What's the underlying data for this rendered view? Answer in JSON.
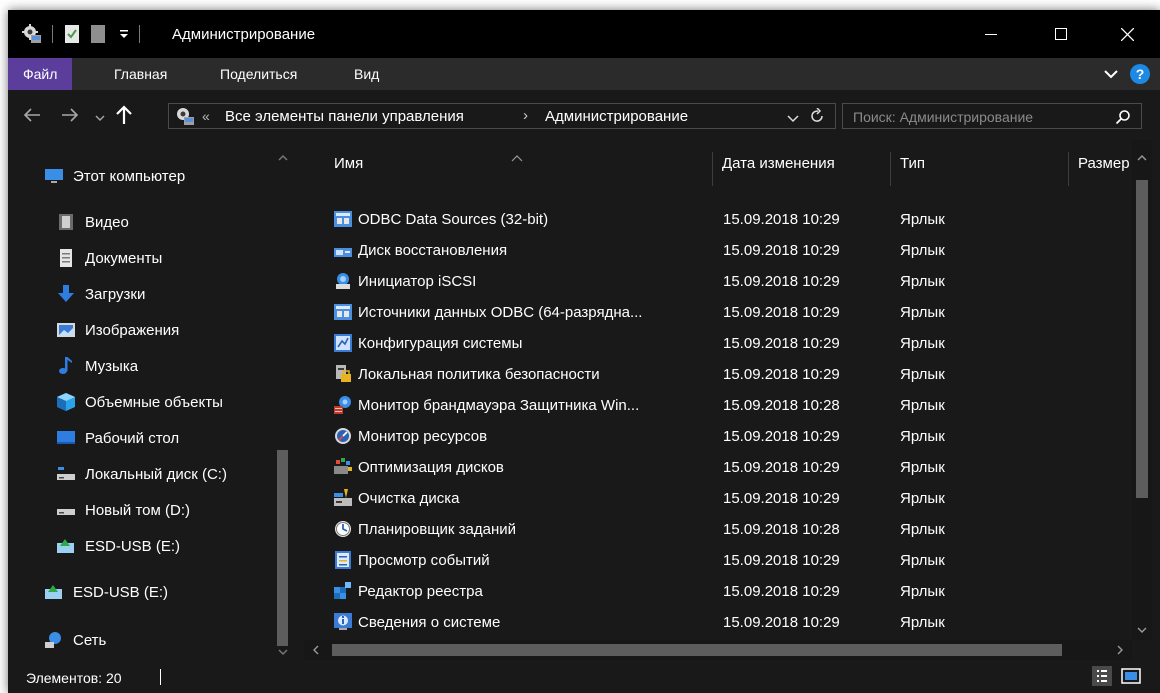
{
  "window": {
    "title": "Администрирование",
    "minimize_glyph": "—",
    "maximize_glyph": "☐",
    "close_glyph": "✕"
  },
  "ribbon": {
    "tabs": [
      "Файл",
      "Главная",
      "Поделиться",
      "Вид"
    ],
    "help_glyph": "?"
  },
  "address": {
    "overflow_glyph": "«",
    "crumbs": [
      "Все элементы панели управления",
      "Администрирование"
    ],
    "sep": "›"
  },
  "search": {
    "placeholder": "Поиск: Администрирование"
  },
  "nav": {
    "items": [
      {
        "label": "Этот компьютер",
        "icon": "monitor-icon"
      },
      {
        "label": "Видео",
        "icon": "video-icon"
      },
      {
        "label": "Документы",
        "icon": "documents-icon"
      },
      {
        "label": "Загрузки",
        "icon": "download-icon"
      },
      {
        "label": "Изображения",
        "icon": "pictures-icon"
      },
      {
        "label": "Музыка",
        "icon": "music-icon"
      },
      {
        "label": "Объемные объекты",
        "icon": "3d-objects-icon"
      },
      {
        "label": "Рабочий стол",
        "icon": "desktop-icon"
      },
      {
        "label": "Локальный диск (C:)",
        "icon": "system-drive-icon"
      },
      {
        "label": "Новый том (D:)",
        "icon": "drive-icon"
      },
      {
        "label": "ESD-USB (E:)",
        "icon": "usb-drive-icon"
      },
      {
        "label": "ESD-USB (E:)",
        "icon": "usb-drive-icon"
      },
      {
        "label": "Сеть",
        "icon": "network-icon"
      }
    ]
  },
  "columns": {
    "name": "Имя",
    "date": "Дата изменения",
    "type": "Тип",
    "size": "Размер"
  },
  "files": [
    {
      "name": "ODBC Data Sources (32-bit)",
      "date": "15.09.2018 10:29",
      "type": "Ярлык"
    },
    {
      "name": "Диск восстановления",
      "date": "15.09.2018 10:29",
      "type": "Ярлык"
    },
    {
      "name": "Инициатор iSCSI",
      "date": "15.09.2018 10:29",
      "type": "Ярлык"
    },
    {
      "name": "Источники данных ODBC (64-разрядна...",
      "date": "15.09.2018 10:29",
      "type": "Ярлык"
    },
    {
      "name": "Конфигурация системы",
      "date": "15.09.2018 10:29",
      "type": "Ярлык"
    },
    {
      "name": "Локальная политика безопасности",
      "date": "15.09.2018 10:29",
      "type": "Ярлык"
    },
    {
      "name": "Монитор брандмауэра Защитника Win...",
      "date": "15.09.2018 10:28",
      "type": "Ярлык"
    },
    {
      "name": "Монитор ресурсов",
      "date": "15.09.2018 10:29",
      "type": "Ярлык"
    },
    {
      "name": "Оптимизация дисков",
      "date": "15.09.2018 10:29",
      "type": "Ярлык"
    },
    {
      "name": "Очистка диска",
      "date": "15.09.2018 10:29",
      "type": "Ярлык"
    },
    {
      "name": "Планировщик заданий",
      "date": "15.09.2018 10:28",
      "type": "Ярлык"
    },
    {
      "name": "Просмотр событий",
      "date": "15.09.2018 10:29",
      "type": "Ярлык"
    },
    {
      "name": "Редактор реестра",
      "date": "15.09.2018 10:29",
      "type": "Ярлык"
    },
    {
      "name": "Сведения о системе",
      "date": "15.09.2018 10:29",
      "type": "Ярлык"
    }
  ],
  "status": {
    "items_text": "Элементов: 20"
  },
  "colors": {
    "title_bg": "#000000",
    "window_bg": "#191919",
    "ribbon_bg": "#2b2b2b",
    "file_tab": "#5b3d9c",
    "accent_blue": "#1e88e5"
  }
}
